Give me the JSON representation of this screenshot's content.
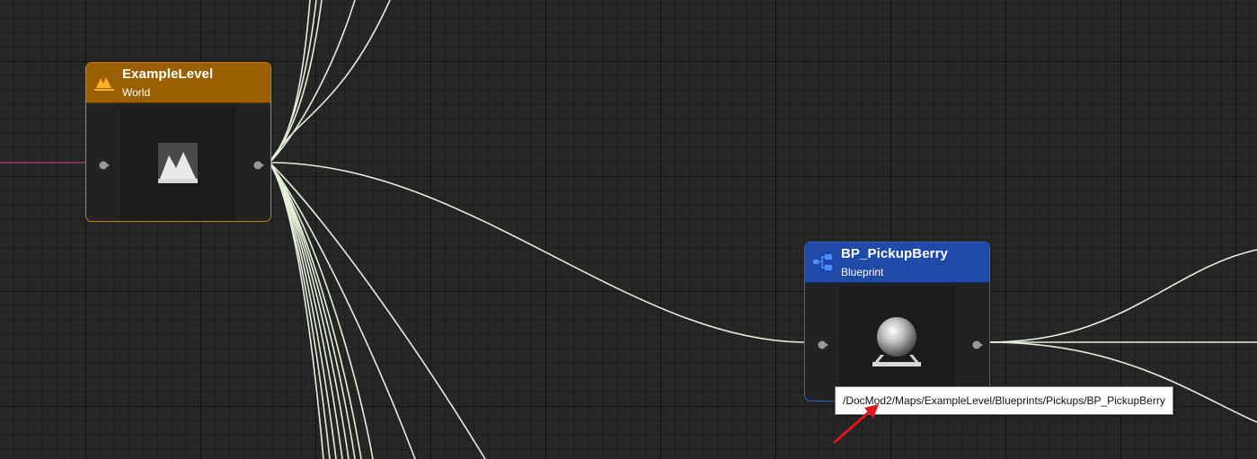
{
  "nodes": [
    {
      "id": "world-node",
      "title": "ExampleLevel",
      "subtitle": "World",
      "header_color": "#9a5f00",
      "border_color": "#c98100",
      "icon": "world-level-icon",
      "thumbnail": "level-thumbnail-icon"
    },
    {
      "id": "blueprint-node",
      "title": "BP_PickupBerry",
      "subtitle": "Blueprint",
      "header_color": "#1f4aa8",
      "border_color": "#2f5fd0",
      "icon": "blueprint-icon",
      "thumbnail": "sphere-thumbnail-icon"
    }
  ],
  "tooltip": {
    "text": "/DocMod2/Maps/ExampleLevel/Blueprints/Pickups/BP_PickupBerry"
  },
  "colors": {
    "graph_background": "#262626",
    "wire": "#e6f2dd",
    "reference_wire": "#9b3d6c",
    "annotation_arrow": "#e0141b"
  }
}
